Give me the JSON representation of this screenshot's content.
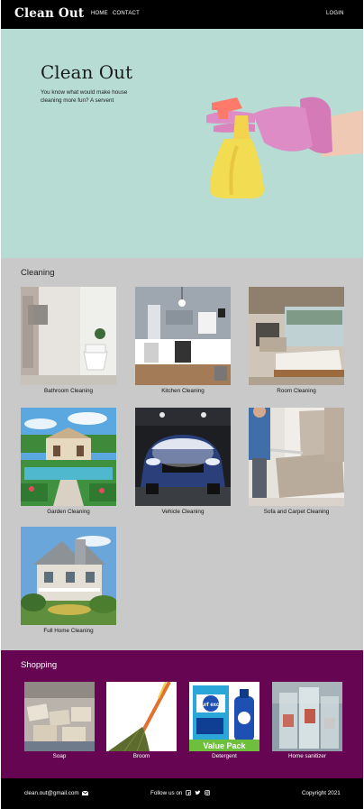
{
  "header": {
    "brand": "Clean Out",
    "nav": {
      "home": "HOME",
      "contact": "CONTACT",
      "login": "LOGIN"
    }
  },
  "hero": {
    "title": "Clean Out",
    "subtitle": "You know what would make house cleaning more fun? A servent"
  },
  "cleaning": {
    "title": "Cleaning",
    "services": [
      {
        "label": "Bathroom Cleaning"
      },
      {
        "label": "Kitchen Cleaning"
      },
      {
        "label": "Room Cleaning"
      },
      {
        "label": "Garden Cleaning"
      },
      {
        "label": "Vehicle Cleaning"
      },
      {
        "label": "Sofa and Carpet Cleaning"
      },
      {
        "label": "Full Home Cleaning"
      }
    ]
  },
  "shopping": {
    "title": "Shopping",
    "products": [
      {
        "label": "Soap"
      },
      {
        "label": "Broom"
      },
      {
        "label": "Detergent",
        "pack_text": "Value Pack",
        "brand_text": "Surf excel"
      },
      {
        "label": "Home sanitizer"
      }
    ]
  },
  "footer": {
    "email": "clean.out@gmail.com",
    "follow": "Follow us on",
    "copyright": "Copyright 2021"
  },
  "colors": {
    "header_bg": "#000000",
    "hero_bg": "#b6dcd3",
    "cleaning_bg": "#c9c9c9",
    "shopping_bg": "#660652",
    "footer_bg": "#000000"
  }
}
